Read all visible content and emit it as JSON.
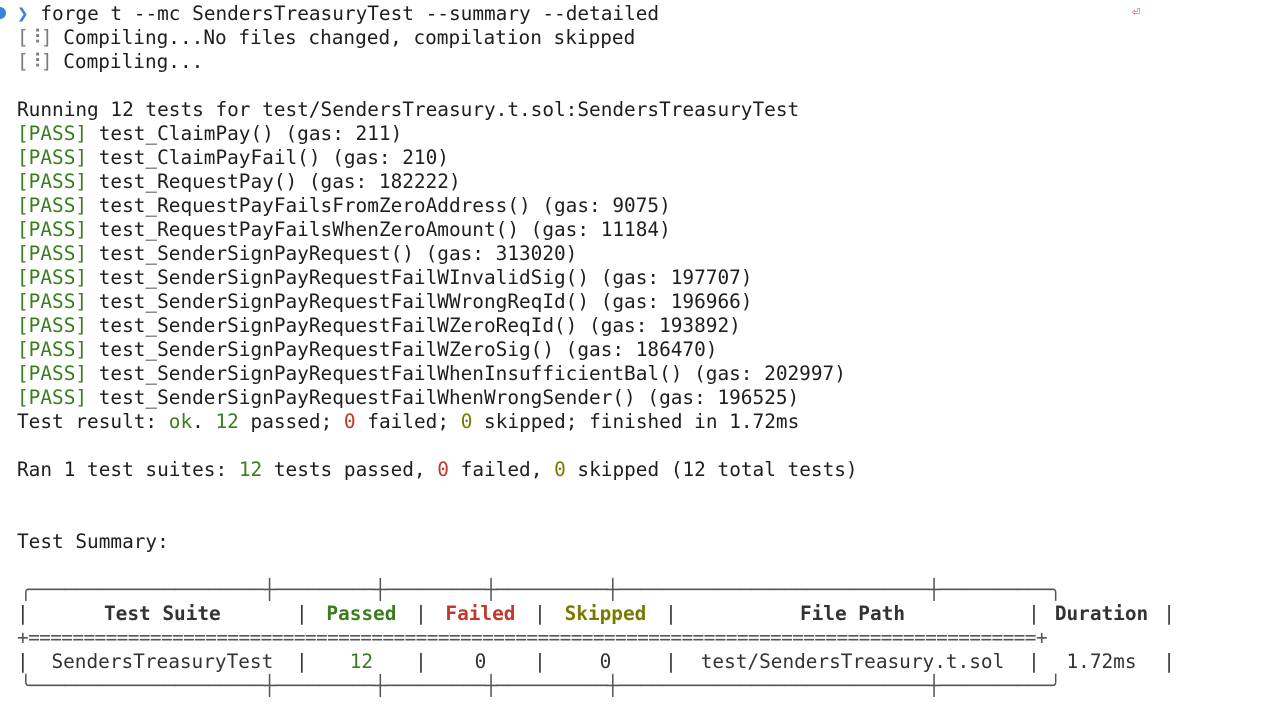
{
  "prompt": {
    "arrow": "❯",
    "command": "forge t --mc SendersTreasuryTest --summary --detailed"
  },
  "compile": [
    {
      "spinner": "[⠸]",
      "text": " Compiling...No files changed, compilation skipped"
    },
    {
      "spinner": "[⠸]",
      "text": " Compiling..."
    }
  ],
  "running": "Running 12 tests for test/SendersTreasury.t.sol:SendersTreasuryTest",
  "tests": [
    {
      "status": "[PASS]",
      "text": " test_ClaimPay() (gas: 211)"
    },
    {
      "status": "[PASS]",
      "text": " test_ClaimPayFail() (gas: 210)"
    },
    {
      "status": "[PASS]",
      "text": " test_RequestPay() (gas: 182222)"
    },
    {
      "status": "[PASS]",
      "text": " test_RequestPayFailsFromZeroAddress() (gas: 9075)"
    },
    {
      "status": "[PASS]",
      "text": " test_RequestPayFailsWhenZeroAmount() (gas: 11184)"
    },
    {
      "status": "[PASS]",
      "text": " test_SenderSignPayRequest() (gas: 313020)"
    },
    {
      "status": "[PASS]",
      "text": " test_SenderSignPayRequestFailWInvalidSig() (gas: 197707)"
    },
    {
      "status": "[PASS]",
      "text": " test_SenderSignPayRequestFailWWrongReqId() (gas: 196966)"
    },
    {
      "status": "[PASS]",
      "text": " test_SenderSignPayRequestFailWZeroReqId() (gas: 193892)"
    },
    {
      "status": "[PASS]",
      "text": " test_SenderSignPayRequestFailWZeroSig() (gas: 186470)"
    },
    {
      "status": "[PASS]",
      "text": " test_SenderSignPayRequestFailWhenInsufficientBal() (gas: 202997)"
    },
    {
      "status": "[PASS]",
      "text": " test_SenderSignPayRequestFailWhenWrongSender() (gas: 196525)"
    }
  ],
  "result": {
    "prefix": "Test result: ",
    "ok": "ok",
    "sep1": ". ",
    "passed": "12",
    "passed_label": " passed; ",
    "failed": "0",
    "failed_label": " failed; ",
    "skipped": "0",
    "skipped_label": " skipped; finished in 1.72ms"
  },
  "ran": {
    "prefix": "Ran 1 test suites: ",
    "passed": "12",
    "passed_label": " tests passed, ",
    "failed": "0",
    "failed_label": " failed, ",
    "skipped": "0",
    "skipped_label": " skipped (12 total tests)"
  },
  "summary_title": "Test Summary:",
  "table": {
    "top": "╭─────────────────────┼─────────┼─────────┼──────────┼────────────────────────────┼──────────╮",
    "header": {
      "suite": "Test Suite",
      "passed": "Passed",
      "failed": "Failed",
      "skipped": "Skipped",
      "path": "File Path",
      "duration": "Duration"
    },
    "sep": "+===========================================================================================+",
    "row": {
      "suite": "SendersTreasuryTest",
      "passed": "12",
      "failed": "0",
      "skipped": "0",
      "path": "test/SendersTreasury.t.sol",
      "duration": "1.72ms"
    },
    "bottom": "╰─────────────────────┼─────────┼─────────┼──────────┼────────────────────────────┼──────────╯"
  },
  "colors": {
    "pass": "#3a7d1e",
    "fail": "#c0392b",
    "skip": "#7a7a00",
    "accent": "#3b83d6"
  }
}
